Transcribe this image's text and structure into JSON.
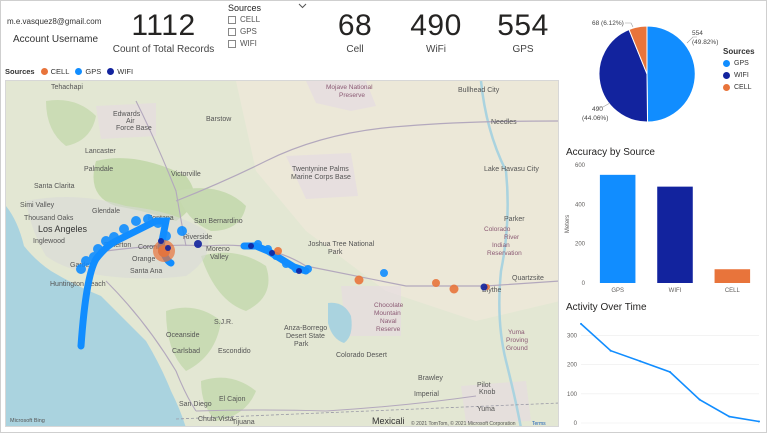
{
  "account": {
    "email": "m.e.vasquez8@gmail.com",
    "label": "Account Username"
  },
  "kpis": {
    "total": {
      "value": "1112",
      "label": "Count of Total Records"
    },
    "cell": {
      "value": "68",
      "label": "Cell"
    },
    "wifi": {
      "value": "490",
      "label": "WiFi"
    },
    "gps": {
      "value": "554",
      "label": "GPS"
    }
  },
  "slicer": {
    "title": "Sources",
    "options": [
      "CELL",
      "GPS",
      "WIFI"
    ]
  },
  "map": {
    "legend_title": "Sources",
    "legend": [
      {
        "name": "CELL",
        "color": "#e8743b"
      },
      {
        "name": "GPS",
        "color": "#118dff"
      },
      {
        "name": "WIFI",
        "color": "#12239e"
      }
    ],
    "labels": {
      "tehachapi": "Tehachapi",
      "bullhead": "Bullhead City",
      "barstow": "Barstow",
      "edwards": "Edwards",
      "air": "Air",
      "base": "Force Base",
      "mojave": "Mojave National",
      "preserve": "Preserve",
      "lancaster": "Lancaster",
      "palmdale": "Palmdale",
      "victorville": "Victorville",
      "santaclarita": "Santa Clarita",
      "simi": "Simi Valley",
      "thousand": "Thousand Oaks",
      "glendale": "Glendale",
      "losangeles": "Los Angeles",
      "inglewood": "Inglewood",
      "fontana": "Fontana",
      "sanbernardino": "San Bernardino",
      "riverside": "Riverside",
      "fullerton": "Fullerton",
      "orange": "Orange",
      "corona": "Corona",
      "santaana": "Santa Ana",
      "moreno": "Moreno",
      "valley": "Valley",
      "garden": "Garden",
      "huntington": "Huntington Beach",
      "twentynine1": "Twentynine Palms",
      "twentynine2": "Marine Corps Base",
      "joshua": "Joshua Tree National",
      "park": "Park",
      "havasu": "Lake Havasu City",
      "needles": "Needles",
      "parker": "Parker",
      "colorado": "Colorado",
      "river": "River",
      "indian": "Indian",
      "reservation": "Reservation",
      "quartzsite": "Quartzsite",
      "blythe": "Blythe",
      "chocolate1": "Chocolate",
      "chocolate2": "Mountain",
      "chocolate3": "Naval",
      "chocolate4": "Reserve",
      "anza1": "Anza-Borrego",
      "anza2": "Desert State",
      "anza3": "Park",
      "coloradodesert": "Colorado Desert",
      "oceanside": "Oceanside",
      "carlsbad": "Carlsbad",
      "escondido": "Escondido",
      "sandiego": "San Diego",
      "elcajon": "El Cajon",
      "chulavista": "Chula Vista",
      "tijuana": "Tijuana",
      "mexicali": "Mexicali",
      "yuma": "Yuma",
      "imperial": "Imperial",
      "brawley": "Brawley",
      "pilot1": "Pilot",
      "pilot2": "Knob",
      "yuma1": "Yuma",
      "yuma2": "Proving",
      "yuma3": "Ground",
      "sjr": "S.J.R.",
      "copyright": "© 2021 TomTom, © 2021 Microsoft Corporation",
      "terms": "Terms",
      "msbing": "Microsoft Bing"
    }
  },
  "pie": {
    "labels": {
      "cell": "68 (6.12%)",
      "gps_value": "554",
      "gps_pct": "(49.82%)",
      "wifi_value": "490",
      "wifi_pct": "(44.06%)"
    },
    "legend_title": "Sources",
    "legend": [
      {
        "name": "GPS",
        "color": "#118dff"
      },
      {
        "name": "WIFI",
        "color": "#12239e"
      },
      {
        "name": "CELL",
        "color": "#e8743b"
      }
    ]
  },
  "accuracy": {
    "title": "Accuracy by Source",
    "ylabel": "Meters"
  },
  "activity": {
    "title": "Activity Over Time"
  },
  "chart_data": [
    {
      "type": "pie",
      "categories": [
        "GPS",
        "WIFI",
        "CELL"
      ],
      "values": [
        554,
        490,
        68
      ],
      "legend_title": "Sources",
      "legend_position": "right"
    },
    {
      "type": "bar",
      "title": "Accuracy by Source",
      "categories": [
        "GPS",
        "WIFI",
        "CELL"
      ],
      "values": [
        550,
        490,
        70
      ],
      "colors": [
        "#118dff",
        "#12239e",
        "#e8743b"
      ],
      "ylabel": "Meters",
      "ylim": [
        0,
        600
      ],
      "yticks": [
        0,
        200,
        400,
        600
      ]
    },
    {
      "type": "line",
      "title": "Activity Over Time",
      "x": [
        0,
        1,
        2,
        3,
        4,
        5,
        6
      ],
      "values": [
        340,
        248,
        212,
        175,
        80,
        22,
        5
      ],
      "color": "#118dff",
      "ylim": [
        0,
        350
      ],
      "yticks": [
        0,
        100,
        200,
        300
      ]
    }
  ]
}
